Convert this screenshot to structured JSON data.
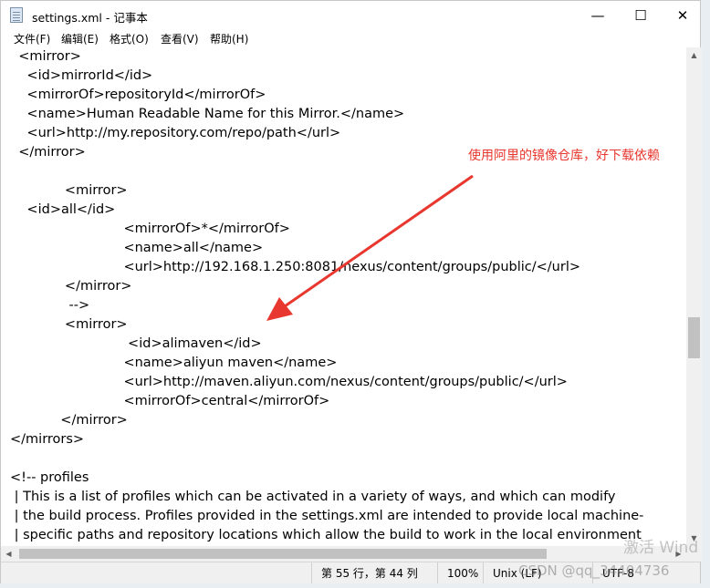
{
  "window": {
    "title": "settings.xml - 记事本",
    "min_glyph": "—",
    "max_glyph": "☐",
    "close_glyph": "✕"
  },
  "menu": {
    "file": "文件(F)",
    "edit": "编辑(E)",
    "format": "格式(O)",
    "view": "查看(V)",
    "help": "帮助(H)"
  },
  "editor": {
    "lines": [
      "  <mirror>",
      "    <id>mirrorId</id>",
      "    <mirrorOf>repositoryId</mirrorOf>",
      "    <name>Human Readable Name for this Mirror.</name>",
      "    <url>http://my.repository.com/repo/path</url>",
      "  </mirror>",
      "",
      "             <mirror>",
      "    <id>all</id>",
      "                           <mirrorOf>*</mirrorOf>",
      "                           <name>all</name>",
      "                           <url>http://192.168.1.250:8081/nexus/content/groups/public/</url>",
      "             </mirror>",
      "              -->",
      "             <mirror>",
      "                            <id>alimaven</id>",
      "                           <name>aliyun maven</name>",
      "                           <url>http://maven.aliyun.com/nexus/content/groups/public/</url>",
      "                           <mirrorOf>central</mirrorOf>",
      "            </mirror>",
      "</mirrors>",
      "",
      "<!-- profiles",
      " | This is a list of profiles which can be activated in a variety of ways, and which can modify",
      " | the build process. Profiles provided in the settings.xml are intended to provide local machine-",
      " | specific paths and repository locations which allow the build to work in the local environment"
    ]
  },
  "annotation": {
    "text": "使用阿里的镜像仓库，好下载依赖",
    "color": "#e8372e"
  },
  "scrollbars": {
    "up_glyph": "▲",
    "down_glyph": "▼",
    "left_glyph": "◀",
    "right_glyph": "▶"
  },
  "status": {
    "position": "第 55 行，第 44 列",
    "zoom": "100%",
    "line_ending": "Unix (LF)",
    "encoding": "UTF-8"
  },
  "watermarks": {
    "windows": "激活 Wind",
    "csdn": "CSDN @qq_34404736"
  }
}
